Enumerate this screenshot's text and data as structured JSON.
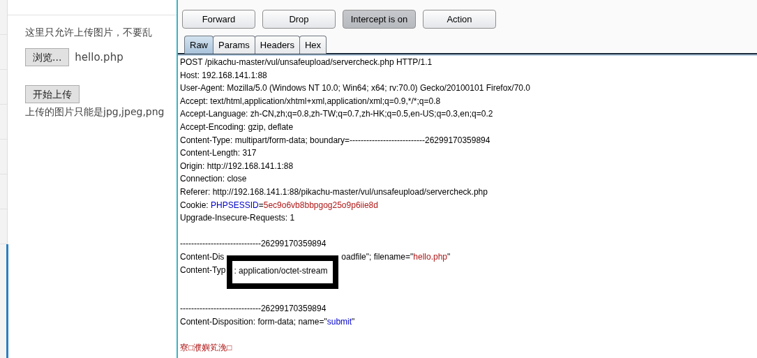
{
  "page": {
    "notice": "这里只允许上传图片，不要乱",
    "browse_button": "浏览...",
    "file_name": "hello.php",
    "upload_button": "开始上传",
    "hint": "上传的图片只能是jpg,jpeg,png"
  },
  "proxy": {
    "buttons": [
      {
        "label": "Forward",
        "pressed": false
      },
      {
        "label": "Drop",
        "pressed": false
      },
      {
        "label": "Intercept is on",
        "pressed": true
      },
      {
        "label": "Action",
        "pressed": false
      }
    ],
    "tabs": [
      {
        "label": "Raw",
        "selected": true
      },
      {
        "label": "Params",
        "selected": false
      },
      {
        "label": "Headers",
        "selected": false
      },
      {
        "label": "Hex",
        "selected": false
      }
    ],
    "request_lines": [
      {
        "kind": "text",
        "segments": [
          {
            "kind": "plain",
            "text": "POST /pikachu-master/vul/unsafeupload/servercheck.php HTTP/1.1"
          }
        ]
      },
      {
        "kind": "text",
        "segments": [
          {
            "kind": "plain",
            "text": "Host: 192.168.141.1:88"
          }
        ]
      },
      {
        "kind": "text",
        "segments": [
          {
            "kind": "plain",
            "text": "User-Agent: Mozilla/5.0 (Windows NT 10.0; Win64; x64; rv:70.0) Gecko/20100101 Firefox/70.0"
          }
        ]
      },
      {
        "kind": "text",
        "segments": [
          {
            "kind": "plain",
            "text": "Accept: text/html,application/xhtml+xml,application/xml;q=0.9,*/*;q=0.8"
          }
        ]
      },
      {
        "kind": "text",
        "segments": [
          {
            "kind": "plain",
            "text": "Accept-Language: zh-CN,zh;q=0.8,zh-TW;q=0.7,zh-HK;q=0.5,en-US;q=0.3,en;q=0.2"
          }
        ]
      },
      {
        "kind": "text",
        "segments": [
          {
            "kind": "plain",
            "text": "Accept-Encoding: gzip, deflate"
          }
        ]
      },
      {
        "kind": "text",
        "segments": [
          {
            "kind": "plain",
            "text": "Content-Type: multipart/form-data; boundary=---------------------------26299170359894"
          }
        ]
      },
      {
        "kind": "text",
        "segments": [
          {
            "kind": "plain",
            "text": "Content-Length: 317"
          }
        ]
      },
      {
        "kind": "text",
        "segments": [
          {
            "kind": "plain",
            "text": "Origin: http://192.168.141.1:88"
          }
        ]
      },
      {
        "kind": "text",
        "segments": [
          {
            "kind": "plain",
            "text": "Connection: close"
          }
        ]
      },
      {
        "kind": "text",
        "segments": [
          {
            "kind": "plain",
            "text": "Referer: http://192.168.141.1:88/pikachu-master/vul/unsafeupload/servercheck.php"
          }
        ]
      },
      {
        "kind": "text",
        "segments": [
          {
            "kind": "plain",
            "text": "Cookie: "
          },
          {
            "kind": "name",
            "text": "PHPSESSID"
          },
          {
            "kind": "plain",
            "text": "="
          },
          {
            "kind": "value",
            "text": "5ec9o6vb8bbpgog25o9p6iie8d"
          }
        ]
      },
      {
        "kind": "text",
        "segments": [
          {
            "kind": "plain",
            "text": "Upgrade-Insecure-Requests: 1"
          }
        ]
      },
      {
        "kind": "blank"
      },
      {
        "kind": "text",
        "segments": [
          {
            "kind": "plain",
            "text": "-----------------------------26299170359894"
          }
        ]
      },
      {
        "kind": "text",
        "segments": [
          {
            "kind": "plain",
            "text": "Content-Dis"
          },
          {
            "kind": "covered"
          },
          {
            "kind": "plain",
            "text": "oadfile\"; filename=\""
          },
          {
            "kind": "value",
            "text": "hello.php"
          },
          {
            "kind": "plain",
            "text": "\""
          }
        ]
      },
      {
        "kind": "text",
        "segments": [
          {
            "kind": "plain",
            "text": "Content-Typ"
          },
          {
            "kind": "boxed",
            "text": ": application/octet-stream"
          }
        ]
      },
      {
        "kind": "blank"
      },
      {
        "kind": "blank"
      },
      {
        "kind": "text",
        "segments": [
          {
            "kind": "plain",
            "text": "-----------------------------26299170359894"
          }
        ]
      },
      {
        "kind": "text",
        "segments": [
          {
            "kind": "plain",
            "text": "Content-Disposition: form-data; name=\""
          },
          {
            "kind": "name",
            "text": "submit"
          },
          {
            "kind": "plain",
            "text": "\""
          }
        ]
      },
      {
        "kind": "blank"
      },
      {
        "kind": "text",
        "segments": [
          {
            "kind": "value",
            "text": "寮□濮嬩笂浼□"
          }
        ]
      }
    ]
  }
}
